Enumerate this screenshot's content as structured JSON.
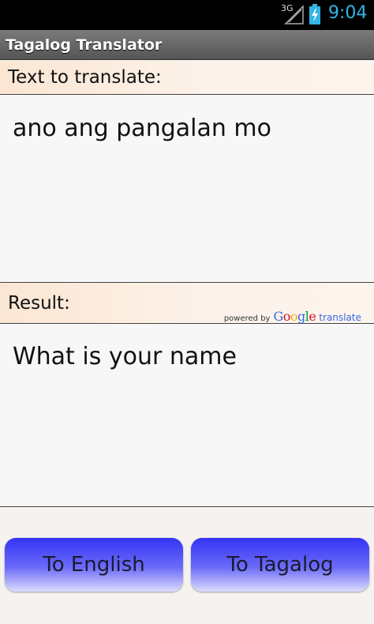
{
  "status_bar": {
    "network": "3G",
    "time": "9:04",
    "colors": {
      "accent": "#33b5e5",
      "background": "#000000"
    }
  },
  "app": {
    "title": "Tagalog Translator"
  },
  "input_section": {
    "label": "Text to translate:",
    "value": "ano ang pangalan mo"
  },
  "result_section": {
    "label": "Result:",
    "value": "What is your name",
    "attribution": {
      "powered_by": "powered by",
      "brand_letters": [
        "G",
        "o",
        "o",
        "g",
        "l",
        "e"
      ],
      "translate": "translate"
    }
  },
  "buttons": {
    "to_english": "To English",
    "to_tagalog": "To Tagalog",
    "color": "#3434f5"
  }
}
